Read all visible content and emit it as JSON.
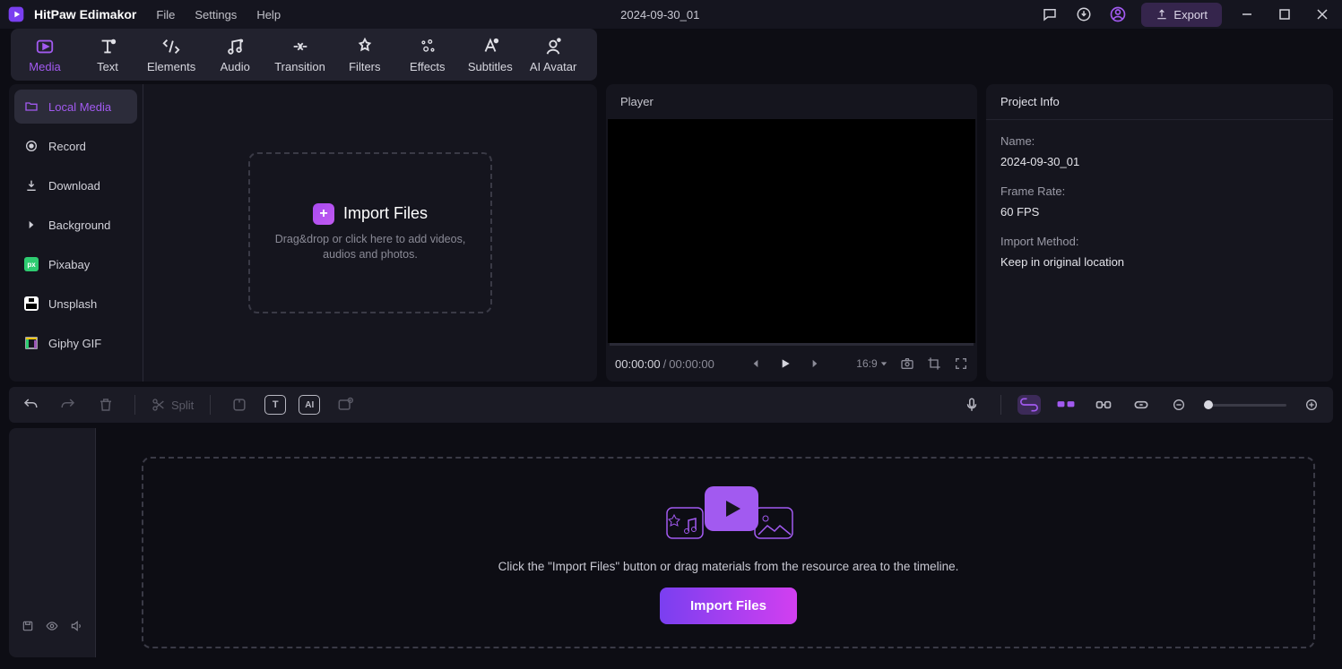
{
  "titlebar": {
    "app_name": "HitPaw Edimakor",
    "menus": [
      "File",
      "Settings",
      "Help"
    ],
    "project_title": "2024-09-30_01",
    "export_label": "Export"
  },
  "top_tabs": [
    {
      "label": "Media"
    },
    {
      "label": "Text"
    },
    {
      "label": "Elements"
    },
    {
      "label": "Audio"
    },
    {
      "label": "Transition"
    },
    {
      "label": "Filters"
    },
    {
      "label": "Effects"
    },
    {
      "label": "Subtitles"
    },
    {
      "label": "AI Avatar"
    }
  ],
  "sidebar": [
    {
      "label": "Local Media"
    },
    {
      "label": "Record"
    },
    {
      "label": "Download"
    },
    {
      "label": "Background"
    },
    {
      "label": "Pixabay"
    },
    {
      "label": "Unsplash"
    },
    {
      "label": "Giphy GIF"
    }
  ],
  "import_box": {
    "title": "Import Files",
    "subtitle": "Drag&drop or click here to add videos, audios and photos."
  },
  "player": {
    "title": "Player",
    "time_current": "00:00:00",
    "time_total": "00:00:00",
    "aspect": "16:9"
  },
  "project_info": {
    "title": "Project Info",
    "name_label": "Name:",
    "name_value": "2024-09-30_01",
    "framerate_label": "Frame Rate:",
    "framerate_value": "60 FPS",
    "import_label": "Import Method:",
    "import_value": "Keep in original location"
  },
  "timeline_toolbar": {
    "split_label": "Split"
  },
  "timeline": {
    "hint": "Click the \"Import Files\" button or drag materials from the resource area to the timeline.",
    "import_button": "Import Files"
  }
}
